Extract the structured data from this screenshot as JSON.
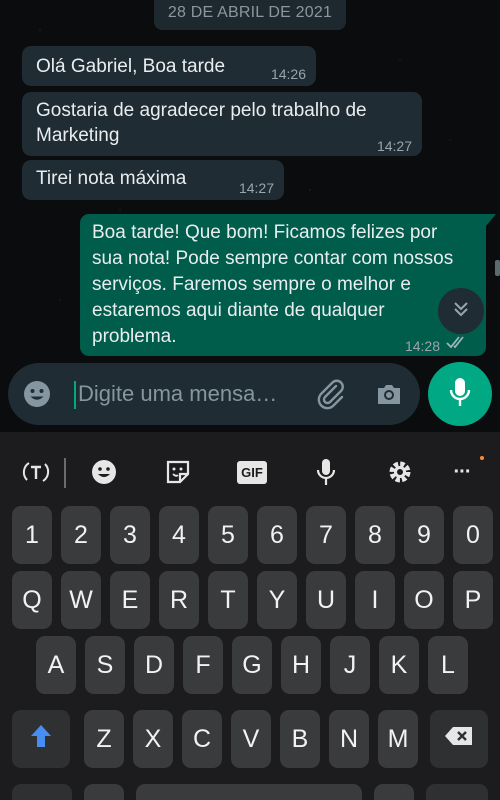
{
  "chat": {
    "date_chip": "28 DE ABRIL DE 2021",
    "messages": [
      {
        "text": "Olá Gabriel, Boa tarde",
        "time": "14:26",
        "direction": "incoming"
      },
      {
        "text": "Gostaria de agradecer pelo trabalho de Marketing",
        "time": "14:27",
        "direction": "incoming"
      },
      {
        "text": "Tirei nota máxima",
        "time": "14:27",
        "direction": "incoming"
      },
      {
        "text": "Boa tarde! Que bom! Ficamos felizes por sua nota! Pode sempre contar com nossos serviços. Faremos sempre o melhor e estaremos aqui diante de qualquer problema.",
        "time": "14:28",
        "direction": "outgoing",
        "status": "read-ticks-icon"
      }
    ]
  },
  "composer": {
    "placeholder": "Digite uma mensa…"
  },
  "keyboard": {
    "toolbar": {
      "gif_label": "GIF",
      "more_label": "···"
    },
    "rows": [
      [
        "1",
        "2",
        "3",
        "4",
        "5",
        "6",
        "7",
        "8",
        "9",
        "0"
      ],
      [
        "Q",
        "W",
        "E",
        "R",
        "T",
        "Y",
        "U",
        "I",
        "O",
        "P"
      ],
      [
        "A",
        "S",
        "D",
        "F",
        "G",
        "H",
        "J",
        "K",
        "L"
      ],
      [
        "Z",
        "X",
        "C",
        "V",
        "B",
        "N",
        "M"
      ]
    ]
  },
  "colors": {
    "accent": "#00a884",
    "incoming_bubble": "#1f2c33",
    "outgoing_bubble": "#005c4b",
    "shift_arrow": "#4a8df0"
  }
}
